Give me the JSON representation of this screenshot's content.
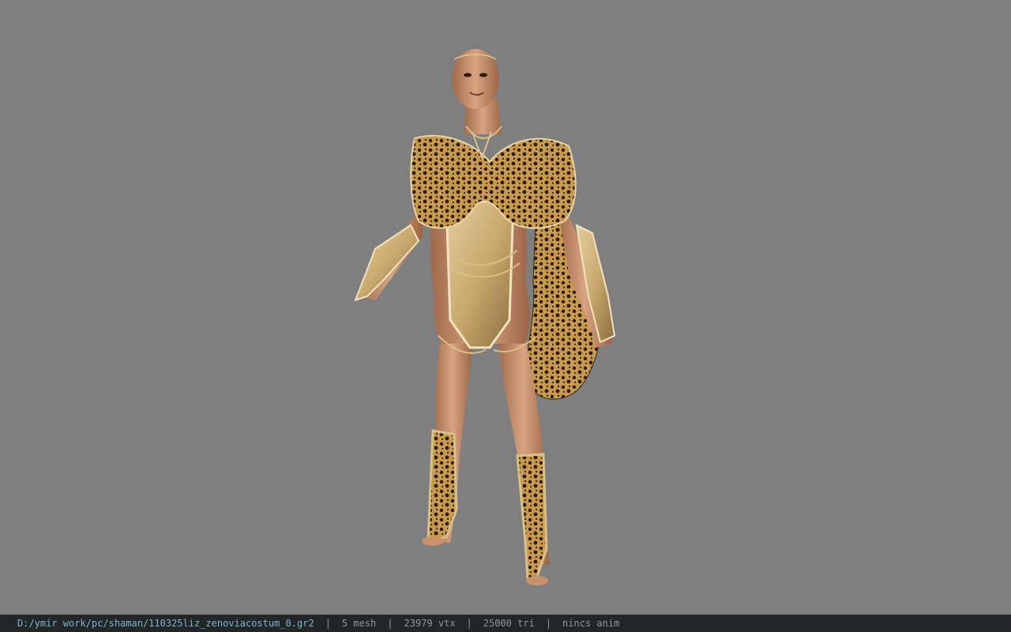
{
  "viewer": {
    "background_color": "#7f7f7f",
    "model_preview": "character-model"
  },
  "status": {
    "file_path": "D:/ymir work/pc/shaman/110325liz_zenoviacostum_0.gr2",
    "separator": "|",
    "mesh_count": "5 mesh",
    "vertex_count": "23979 vtx",
    "triangle_count": "25000 tri",
    "animation": "nincs anim"
  }
}
